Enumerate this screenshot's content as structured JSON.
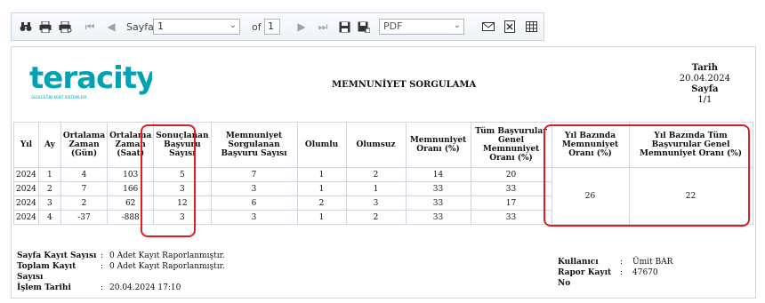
{
  "toolbar": {
    "page_label": "Sayfa",
    "page_value": "1",
    "of_label": "of",
    "total_pages": "1",
    "format_value": "PDF"
  },
  "brand": {
    "logo_text": "teracity",
    "logo_tagline": "GELECEĞİN KENT SİSTEMLERİ",
    "accent": "#00a3b4"
  },
  "report": {
    "title": "MEMNUNİYET SORGULAMA",
    "date_label": "Tarih",
    "date_value": "20.04.2024",
    "page_label": "Sayfa",
    "page_value": "1/1"
  },
  "table": {
    "headers": [
      "Yıl",
      "Ay",
      "Ortalama Zaman (Gün)",
      "Ortalama Zaman (Saat)",
      "Sonuçlanan Başvuru Sayısı",
      "Memnuniyet Sorgulanan Başvuru Sayısı",
      "Olumlu",
      "Olumsuz",
      "Memnuniyet Oranı (%)",
      "Tüm Başvurular Genel Memnuniyet Oranı (%)",
      "Yıl Bazında Memnuniyet Oranı (%)",
      "Yıl Bazında Tüm Başvurular Genel Memnuniyet Oranı (%)"
    ],
    "rows": [
      [
        "2024",
        "1",
        "4",
        "103",
        "5",
        "7",
        "1",
        "2",
        "14",
        "20"
      ],
      [
        "2024",
        "2",
        "7",
        "166",
        "3",
        "3",
        "1",
        "1",
        "33",
        "33"
      ],
      [
        "2024",
        "3",
        "2",
        "62",
        "12",
        "6",
        "2",
        "3",
        "33",
        "17"
      ],
      [
        "2024",
        "4",
        "-37",
        "-888",
        "3",
        "3",
        "1",
        "2",
        "33",
        "33"
      ]
    ],
    "year_rate": "26",
    "year_general_rate": "22"
  },
  "footer": {
    "page_count_label": "Sayfa Kayıt Sayısı",
    "page_count_value": "0 Adet Kayıt Raporlanmıştır.",
    "total_count_label": "Toplam Kayıt Sayısı",
    "total_count_value": "0 Adet Kayıt Raporlanmıştır.",
    "process_date_label": "İşlem Tarihi",
    "process_date_value": "20.04.2024 17:10",
    "user_label": "Kullanıcı",
    "user_value": "Ümit BAR",
    "record_no_label": "Rapor Kayıt No",
    "record_no_value": "47670"
  },
  "colors": {
    "highlight": "#e31b23",
    "border": "#cfd6df"
  }
}
